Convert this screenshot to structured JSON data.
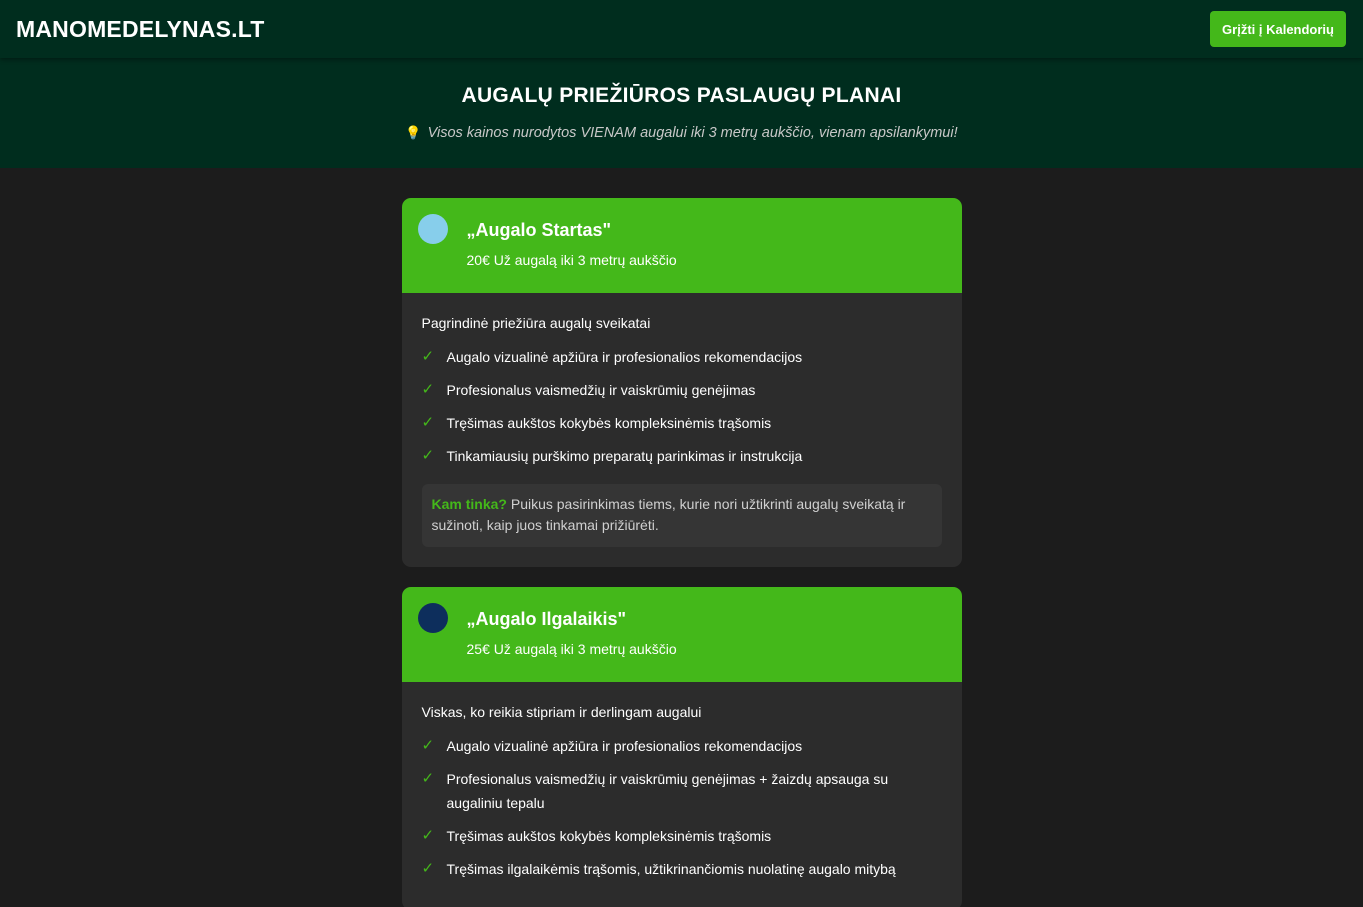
{
  "header": {
    "logo": "MANOMEDELYNAS.LT",
    "back_button": "Grįžti į Kalendorių"
  },
  "hero": {
    "title": "AUGALŲ PRIEŽIŪROS PASLAUGŲ PLANAI",
    "note_icon": "lightbulb-icon",
    "note": "Visos kainos nurodytos VIENAM augalui iki 3 metrų aukščio, vienam apsilankymui!"
  },
  "colors": {
    "accent": "#44b81a",
    "header_bg": "#002d1e",
    "page_bg": "#1c1c1c",
    "card_bg": "#2c2c2c"
  },
  "plans": [
    {
      "dot_color": "#87ceeb",
      "name": "„Augalo Startas\"",
      "price": "20€ Už augalą iki 3 metrų aukščio",
      "intro": "Pagrindinė priežiūra augalų sveikatai",
      "features": [
        "Augalo vizualinė apžiūra ir profesionalios rekomendacijos",
        "Profesionalus vaismedžių ir vaiskrūmių genėjimas",
        "Tręšimas aukštos kokybės kompleksinėmis trąšomis",
        "Tinkamiausių purškimo preparatų parinkimas ir instrukcija"
      ],
      "fit_label": "Kam tinka?",
      "fit_text": "Puikus pasirinkimas tiems, kurie nori užtikrinti augalų sveikatą ir sužinoti, kaip juos tinkamai prižiūrėti."
    },
    {
      "dot_color": "#0d2e5c",
      "name": "„Augalo Ilgalaikis\"",
      "price": "25€ Už augalą iki 3 metrų aukščio",
      "intro": "Viskas, ko reikia stipriam ir derlingam augalui",
      "features": [
        "Augalo vizualinė apžiūra ir profesionalios rekomendacijos",
        "Profesionalus vaismedžių ir vaiskrūmių genėjimas + žaizdų apsauga su augaliniu tepalu",
        "Tręšimas aukštos kokybės kompleksinėmis trąšomis",
        "Tręšimas ilgalaikėmis trąšomis, užtikrinančiomis nuolatinę augalo mitybą"
      ]
    }
  ]
}
